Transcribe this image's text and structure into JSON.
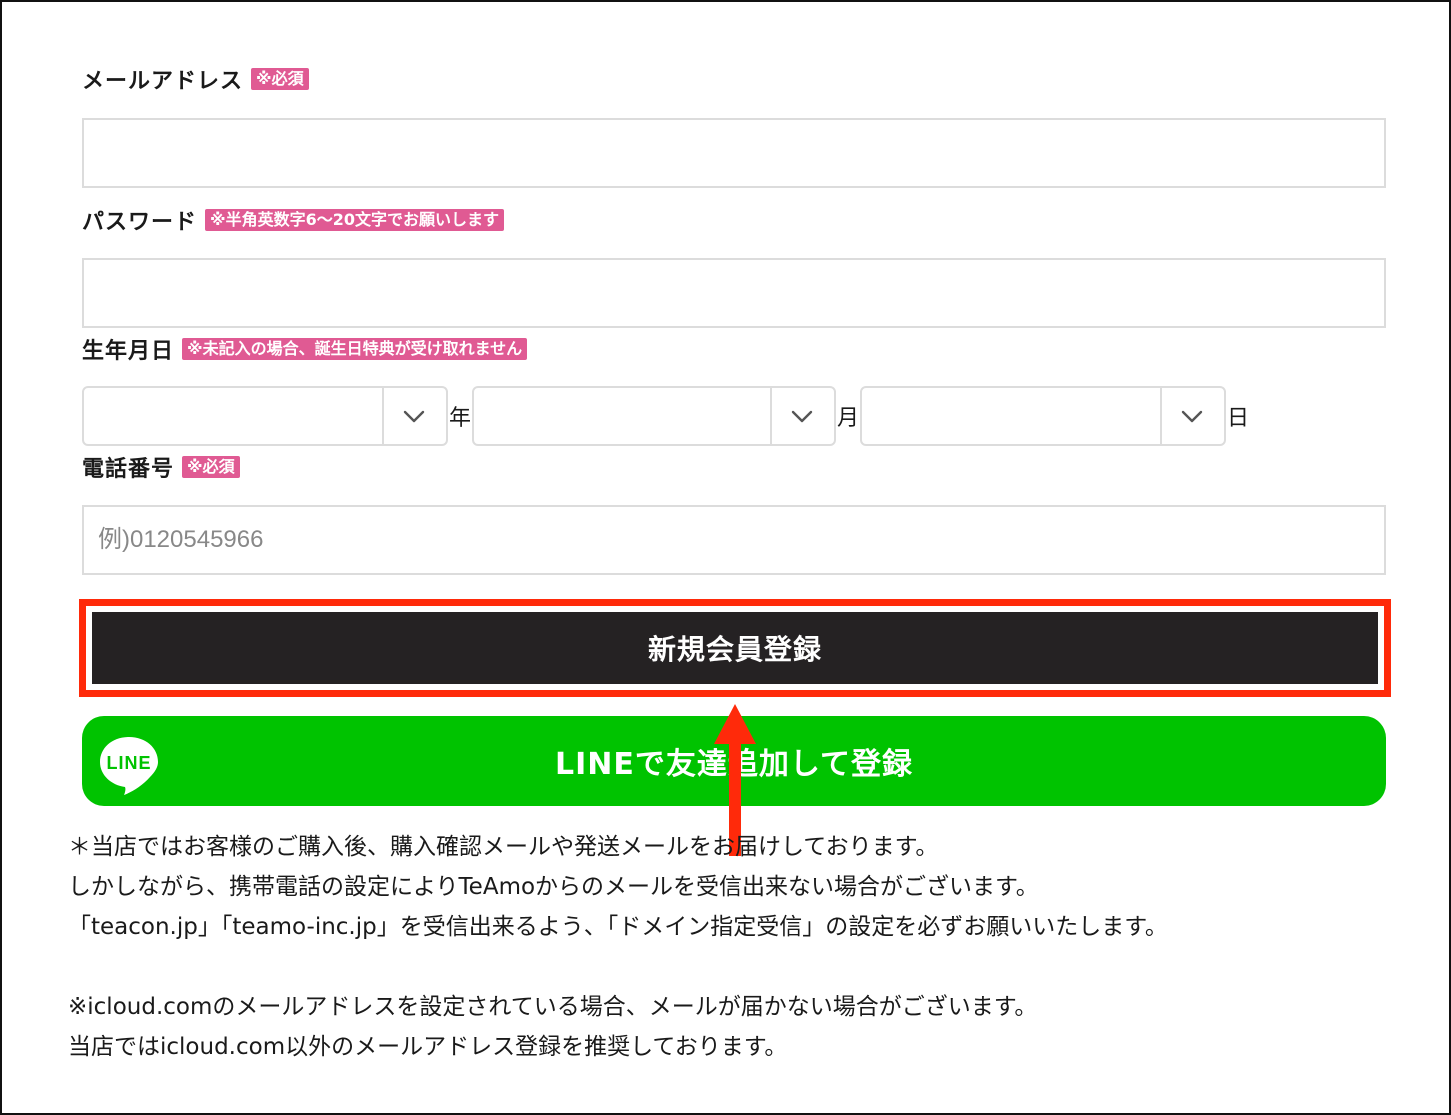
{
  "form": {
    "email": {
      "label": "メールアドレス",
      "badge": "※必須",
      "value": ""
    },
    "password": {
      "label": "パスワード",
      "badge": "※半角英数字6〜20文字でお願いします",
      "value": ""
    },
    "birthday": {
      "label": "生年月日",
      "badge": "※未記入の場合、誕生日特典が受け取れません",
      "year_unit": "年",
      "month_unit": "月",
      "day_unit": "日"
    },
    "phone": {
      "label": "電話番号",
      "badge": "※必須",
      "placeholder": "例)0120545966"
    }
  },
  "buttons": {
    "register": "新規会員登録",
    "line_register": "LINEで友達追加して登録",
    "line_logo_text": "LINE"
  },
  "notes": {
    "line1": "＊当店ではお客様のご購入後、購入確認メールや発送メールをお届けしております。",
    "line2": "しかしながら、携帯電話の設定によりTeAmoからのメールを受信出来ない場合がございます。",
    "line3": "「teacon.jp」「teamo-inc.jp」を受信出来るよう、「ドメイン指定受信」の設定を必ずお願いいたします。",
    "line4": "※icloud.comのメールアドレスを設定されている場合、メールが届かない場合がございます。",
    "line5": "当店ではicloud.com以外のメールアドレス登録を推奨しております。"
  },
  "colors": {
    "badge": "#e05a93",
    "highlight": "#ff2a0a",
    "primary": "#252223",
    "line_green": "#00c300"
  }
}
